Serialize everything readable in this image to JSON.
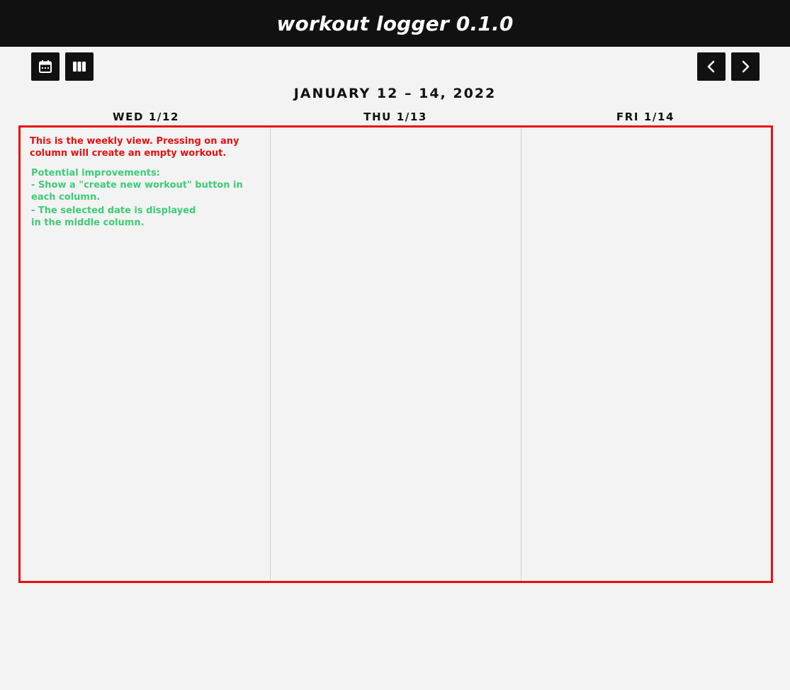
{
  "app": {
    "title": "workout logger 0.1.0"
  },
  "toolbar": {
    "calendar_icon": "calendar-icon",
    "columns_icon": "columns-icon",
    "prev_icon": "chevron-left-icon",
    "next_icon": "chevron-right-icon"
  },
  "week": {
    "range_title": "JANUARY 12 – 14, 2022",
    "days": [
      {
        "label": "WED 1/12"
      },
      {
        "label": "THU 1/13"
      },
      {
        "label": "FRI 1/14"
      }
    ]
  },
  "annotations": {
    "red_note_line1": "This is the weekly view. Pressing on any",
    "red_note_line2": "column will create an empty workout.",
    "green_heading": "Potential improvements:",
    "green_item1_line1": "- Show a \"create new workout\" button in",
    "green_item1_line2": "each column.",
    "green_item2_line1": "- The selected date is displayed",
    "green_item2_line2": "in the middle column."
  },
  "colors": {
    "header_bg": "#111111",
    "page_bg": "#f3f3f3",
    "annotation_red": "#e81010",
    "annotation_green": "#3ecc77"
  }
}
